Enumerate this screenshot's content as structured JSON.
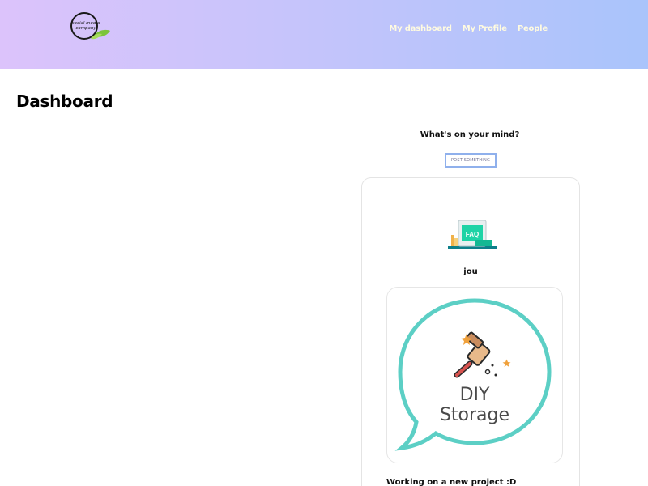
{
  "header": {
    "logo_text": "social media company",
    "nav": [
      {
        "label": "My dashboard"
      },
      {
        "label": "My Profile"
      },
      {
        "label": "People"
      }
    ]
  },
  "page": {
    "title": "Dashboard"
  },
  "composer": {
    "prompt": "What's on your mind?",
    "post_button_label": "POST SOMETHING"
  },
  "post": {
    "avatar_label": "FAQ",
    "author": "jou",
    "image_text_line1": "DIY",
    "image_text_line2": "Storage",
    "caption": "Working on a new project :D"
  },
  "colors": {
    "header_gradient_start": "#dcc3fb",
    "header_gradient_end": "#a9c4fb",
    "nav_text": "#fffbe0",
    "post_button_border": "#8fb0ec",
    "bubble_teal": "#5ccfc5",
    "faq_teal": "#1ed3a6"
  }
}
